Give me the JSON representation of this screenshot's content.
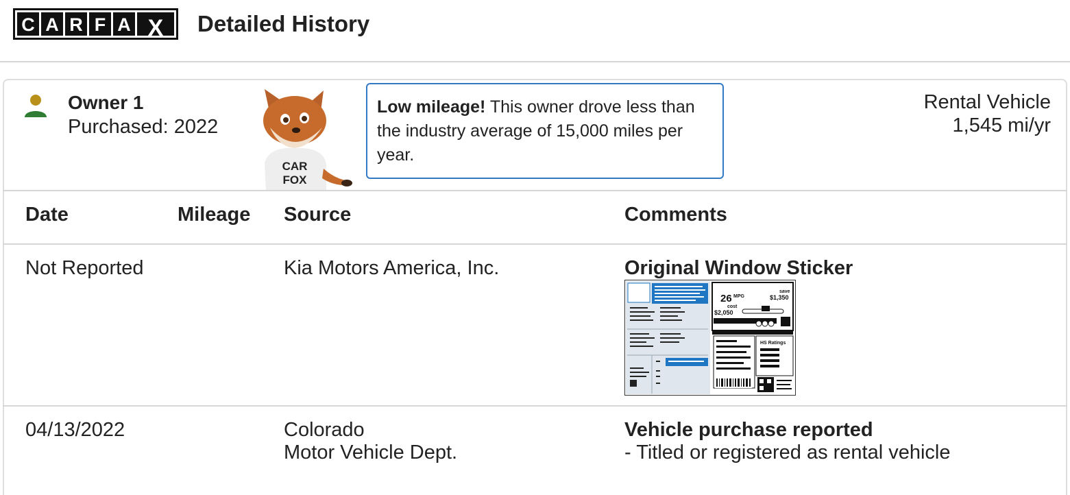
{
  "header": {
    "logo_letters": [
      "C",
      "A",
      "R",
      "F",
      "A",
      "X"
    ],
    "title": "Detailed History"
  },
  "owner": {
    "name": "Owner 1",
    "purchased": "Purchased: 2022",
    "notice_bold": "Low mileage!",
    "notice_text": " This owner drove less than the industry average of 15,000 miles per year.",
    "vehicle_type": "Rental Vehicle",
    "miles_per_year": "1,545 mi/yr",
    "mascot_shirt": [
      "CAR",
      "FOX"
    ]
  },
  "table": {
    "columns": [
      "Date",
      "Mileage",
      "Source",
      "Comments"
    ],
    "rows": [
      {
        "date": "Not Reported",
        "mileage": "",
        "source": [
          "Kia Motors America, Inc."
        ],
        "comment_title": "Original Window Sticker",
        "comment_lines": []
      },
      {
        "date": "04/13/2022",
        "mileage": "",
        "source": [
          "Colorado",
          "Motor Vehicle Dept."
        ],
        "comment_title": "Vehicle purchase reported",
        "comment_lines": [
          "- Titled or registered as rental vehicle"
        ]
      }
    ]
  },
  "sticker": {
    "mpg": "26",
    "mpg_unit": "MPG",
    "save_label": "save",
    "save_amount": "$1,350",
    "cost_label": "cost",
    "cost_amount": "$2,050",
    "ratings_label": "HS Ratings",
    "accent_color": "#1f77c4"
  },
  "colors": {
    "person_head": "#b8901a",
    "person_body": "#2e7d32",
    "notice_border": "#3379c6"
  }
}
